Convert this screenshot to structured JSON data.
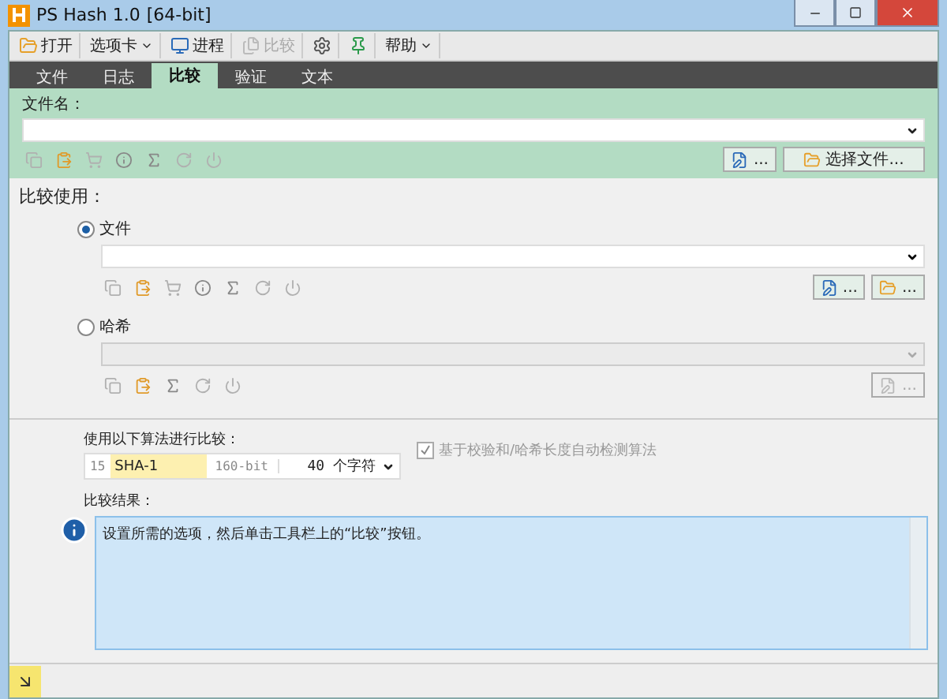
{
  "window": {
    "title": "PS Hash 1.0",
    "title_suffix": "[64-bit]"
  },
  "toolbar": {
    "open": {
      "label": "打开"
    },
    "tabs_menu": {
      "label": "选项卡"
    },
    "process": {
      "label": "进程"
    },
    "compare": {
      "label": "比较",
      "disabled": true
    },
    "help": {
      "label": "帮助"
    }
  },
  "tabs": [
    {
      "label": "文件",
      "selected": false
    },
    {
      "label": "日志",
      "selected": false
    },
    {
      "label": "比较",
      "selected": true
    },
    {
      "label": "验证",
      "selected": false
    },
    {
      "label": "文本",
      "selected": false
    }
  ],
  "file_panel": {
    "label": "文件名：",
    "edit_button": "...",
    "choose_button": "选择文件..."
  },
  "compare_using": {
    "label": "比较使用：",
    "options": [
      {
        "kind": "file",
        "label": "文件",
        "selected": true,
        "buttons": [
          {
            "kind": "edit",
            "text": "...",
            "disabled": false
          },
          {
            "kind": "folder",
            "text": "...",
            "disabled": false
          }
        ]
      },
      {
        "kind": "hash",
        "label": "哈希",
        "selected": false,
        "buttons": [
          {
            "kind": "edit",
            "text": "...",
            "disabled": true
          }
        ]
      }
    ]
  },
  "algorithm": {
    "label": "使用以下算法进行比较：",
    "index": "15",
    "name": "SHA-1",
    "bits": "160-bit",
    "length": "40 个字符"
  },
  "auto_detect": {
    "label": "基于校验和/哈希长度自动检测算法",
    "checked": true,
    "disabled": true
  },
  "result": {
    "label": "比较结果：",
    "message": "设置所需的选项，然后单击工具栏上的“比较”按钮。"
  }
}
